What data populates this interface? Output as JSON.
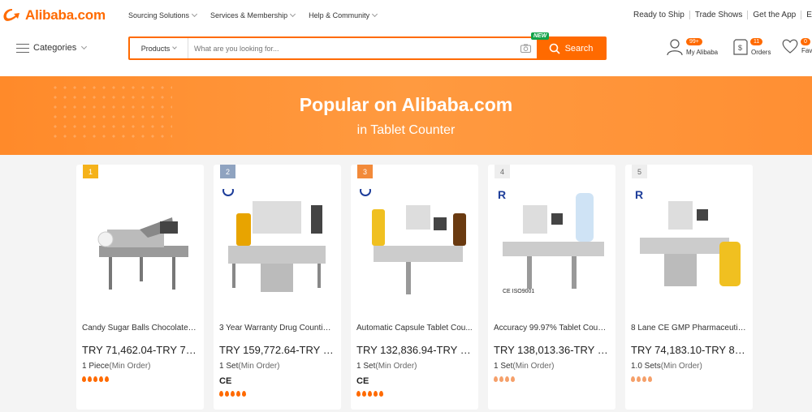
{
  "header": {
    "logo_text": "Alibaba.com",
    "nav": [
      "Sourcing Solutions",
      "Services & Membership",
      "Help & Community"
    ],
    "right_links": [
      "Ready to Ship",
      "Trade Shows",
      "Get the App",
      "Engl"
    ],
    "categories_label": "Categories",
    "search": {
      "category": "Products",
      "placeholder": "What are you looking for...",
      "button_label": "Search",
      "new_badge": "NEW"
    },
    "account": {
      "my_alibaba_label": "My Alibaba",
      "my_alibaba_badge": "99+",
      "orders_label": "Orders",
      "orders_badge": "11",
      "favorites_label": "Fav",
      "favorites_badge": "0"
    }
  },
  "banner": {
    "title": "Popular on Alibaba.com",
    "subtitle": "in Tablet Counter"
  },
  "products": [
    {
      "rank": "1",
      "name": "Candy Sugar Balls Chocolate C...",
      "price": "TRY 71,462.04-TRY 75,...",
      "moq_qty": "1 Piece",
      "moq_unit": "(Min Order)",
      "cert": "",
      "flames": 5
    },
    {
      "rank": "2",
      "name": "3 Year Warranty Drug Counting...",
      "price": "TRY 159,772.64-TRY 17...",
      "moq_qty": "1 Set",
      "moq_unit": "(Min Order)",
      "cert": "CE",
      "flames": 5
    },
    {
      "rank": "3",
      "name": "Automatic Capsule Tablet Cou...",
      "price": "TRY 132,836.94-TRY 14...",
      "moq_qty": "1 Set",
      "moq_unit": "(Min Order)",
      "cert": "CE",
      "flames": 5
    },
    {
      "rank": "4",
      "name": "Accuracy 99.97% Tablet Counti...",
      "price": "TRY 138,013.36-TRY 15...",
      "moq_qty": "1 Set",
      "moq_unit": "(Min Order)",
      "cert": "",
      "flames": 4
    },
    {
      "rank": "5",
      "name": "8 Lane CE GMP Pharmaceutic...",
      "price": "TRY 74,183.10-TRY 82,...",
      "moq_qty": "1.0 Sets",
      "moq_unit": "(Min Order)",
      "cert": "",
      "flames": 4
    }
  ],
  "colors": {
    "accent": "#ff6a00",
    "banner": "#ff8f33",
    "new_badge": "#12a34a"
  }
}
